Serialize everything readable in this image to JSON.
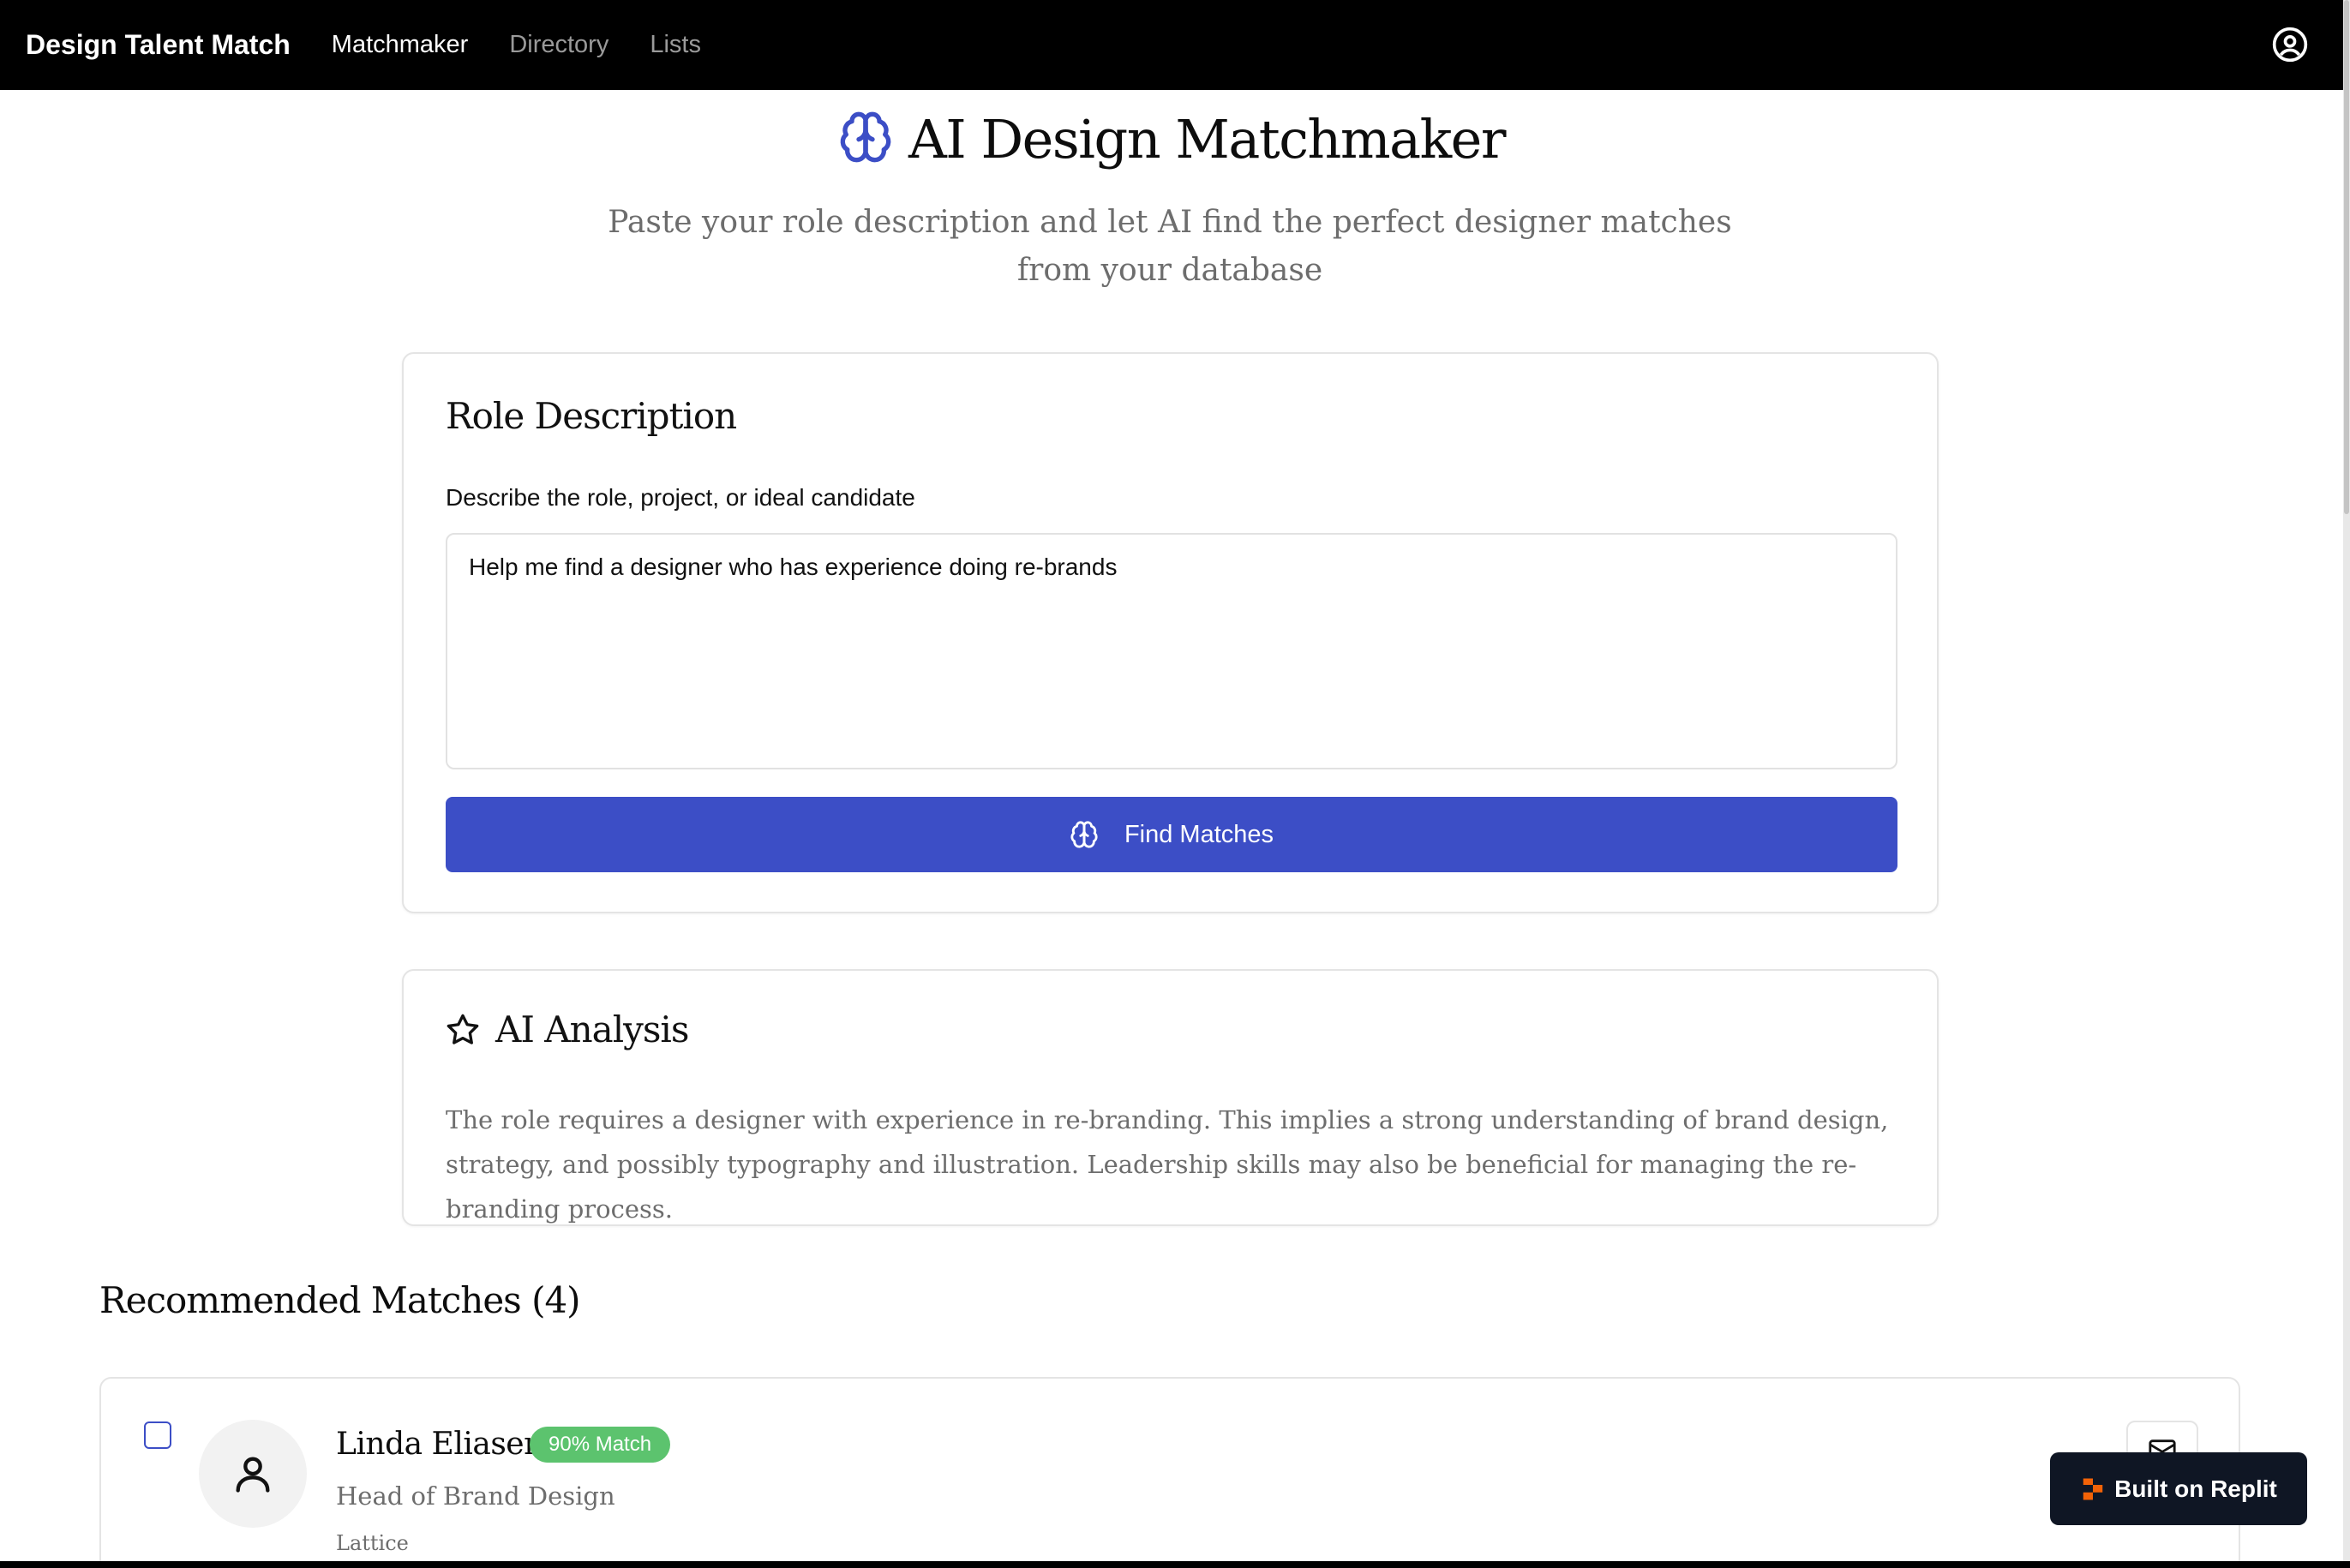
{
  "nav": {
    "brand": "Design Talent Match",
    "links": [
      {
        "label": "Matchmaker",
        "active": true
      },
      {
        "label": "Directory",
        "active": false
      },
      {
        "label": "Lists",
        "active": false
      }
    ],
    "account_icon": "user-circle-icon"
  },
  "hero": {
    "title": "AI Design Matchmaker",
    "subtitle": "Paste your role description and let AI find the perfect designer matches from your database",
    "icon": "brain-icon"
  },
  "role_card": {
    "title": "Role Description",
    "field_label": "Describe the role, project, or ideal candidate",
    "field_value": "Help me find a designer who has experience doing re-brands",
    "button_label": "Find Matches",
    "button_icon": "brain-icon"
  },
  "analysis": {
    "title": "AI Analysis",
    "icon": "star-icon",
    "text": "The role requires a designer with experience in re-branding. This implies a strong understanding of brand design, strategy, and possibly typography and illustration. Leadership skills may also be beneficial for managing the re-branding process."
  },
  "matches": {
    "title": "Recommended Matches (4)",
    "items": [
      {
        "name": "Linda Eliasen",
        "badge": "90% Match",
        "role": "Head of Brand Design",
        "company": "Lattice",
        "selected": false
      }
    ]
  },
  "replit": {
    "label": "Built on Replit"
  },
  "colors": {
    "accent": "#3c4ec6",
    "badge": "#5cc36e",
    "nav_bg": "#000000",
    "muted_text": "#6d6d6d"
  }
}
